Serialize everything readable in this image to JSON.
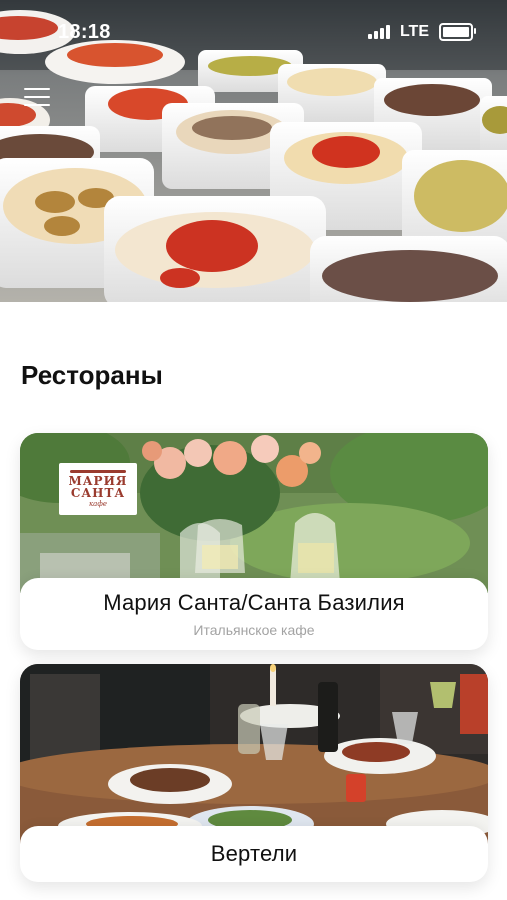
{
  "status_bar": {
    "time": "18:18",
    "network": "LTE",
    "icons": [
      "signal-icon",
      "battery-icon"
    ]
  },
  "header": {
    "menu_icon": "hamburger-menu-icon"
  },
  "section": {
    "title": "Рестораны"
  },
  "restaurants": [
    {
      "name": "Мария Санта/Санта Базилия",
      "subtitle": "Итальянское кафе",
      "logo": {
        "line1": "МАРИЯ",
        "line2": "САНТА",
        "line3": "кафе"
      }
    },
    {
      "name": "Вертели"
    }
  ]
}
